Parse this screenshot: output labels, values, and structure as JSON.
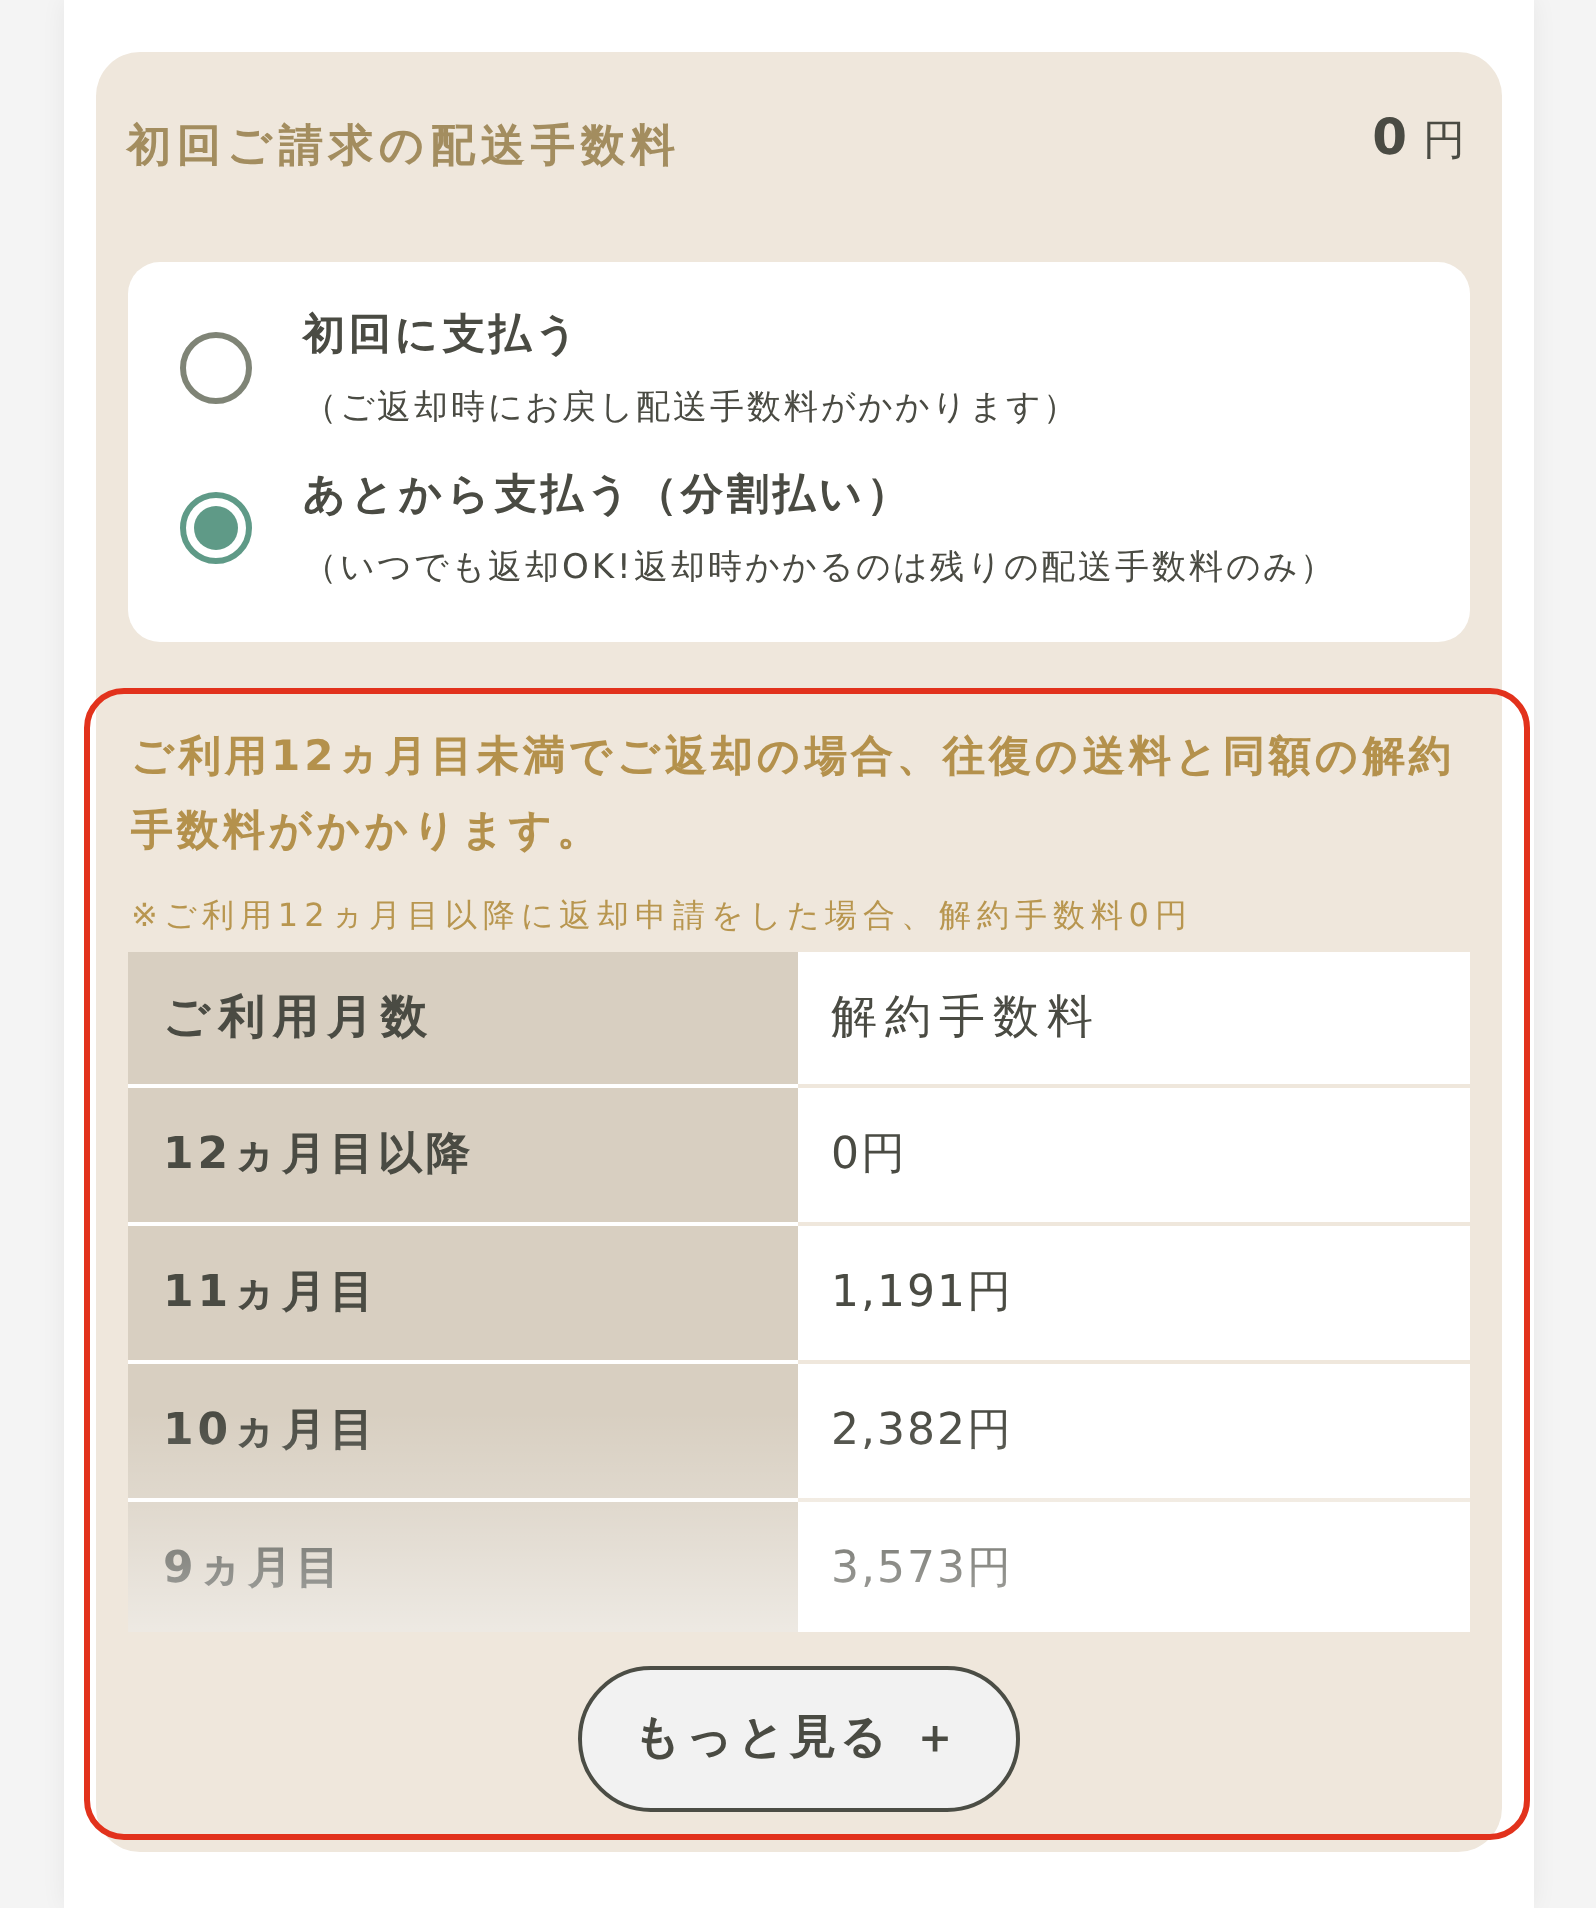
{
  "shipping_fee": {
    "label": "初回ご請求の配送手数料",
    "amount": "0",
    "unit": "円"
  },
  "payment_options": [
    {
      "title": "初回に支払う",
      "note": "（ご返却時にお戻し配送手数料がかかります）",
      "selected": false
    },
    {
      "title": "あとから支払う（分割払い）",
      "note": "（いつでも返却OK!返却時かかるのは残りの配送手数料のみ）",
      "selected": true
    }
  ],
  "cancellation": {
    "warning": "ご利用12ヵ月目未満でご返却の場合、往復の送料と同額の解約手数料がかかります。",
    "note": "※ご利用12ヵ月目以降に返却申請をした場合、解約手数料0円",
    "table": {
      "columns": [
        "ご利用月数",
        "解約手数料"
      ],
      "rows": [
        [
          "12ヵ月目以降",
          "0円"
        ],
        [
          "11ヵ月目",
          "1,191円"
        ],
        [
          "10ヵ月目",
          "2,382円"
        ],
        [
          "9ヵ月目",
          "3,573円"
        ]
      ]
    },
    "more_button": "もっと見る ＋"
  }
}
